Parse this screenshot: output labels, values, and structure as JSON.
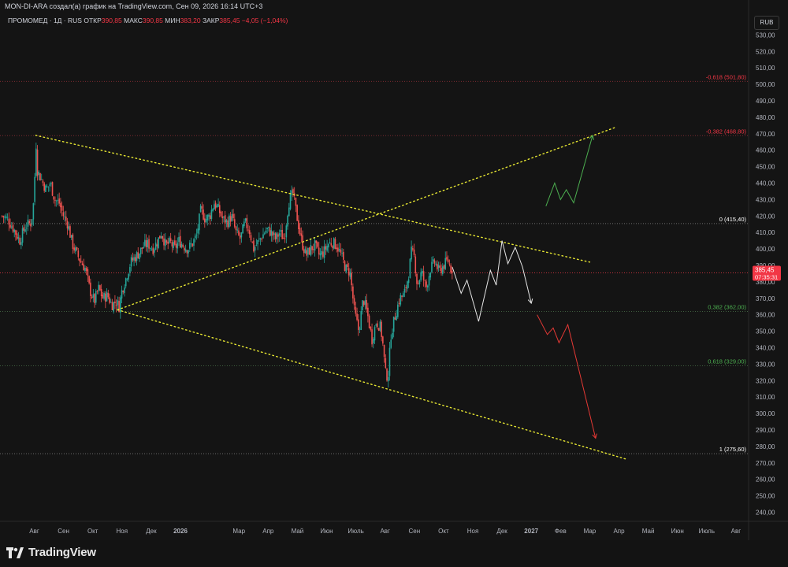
{
  "header": {
    "title": "MON-DI-ARA создал(а) график на TradingView.com, Сен 09, 2026 16:14 UTC+3"
  },
  "legend": {
    "symbol": "ПРОМОМЕД · 1Д · RUS",
    "open_label": "ОТКР",
    "open_value": "390,85",
    "high_label": "МАКС",
    "high_value": "390,85",
    "low_label": "МИН",
    "low_value": "383,20",
    "close_label": "ЗАКР",
    "close_value": "385,45",
    "change": "−4,05 (−1,04%)"
  },
  "price_axis": {
    "currency": "RUB",
    "last_price": "385,45",
    "countdown": "07:35:31"
  },
  "branding": {
    "logo_text": "TradingView"
  },
  "colors": {
    "background": "#141414",
    "up": "#26a69a",
    "down": "#ef5350",
    "trendline": "#e8e832",
    "fib_negative": "#f23645",
    "fib_positive": "#4caf50",
    "fib_neutral": "#ffffff",
    "last_price_tag": "#f23645",
    "scenario_neutral": "#e6e6e6",
    "scenario_bull": "#4caf50",
    "scenario_bear": "#e53935"
  },
  "chart_data": {
    "type": "candlestick",
    "title": "ПРОМОМЕД · 1Д · RUS",
    "ylim": [
      232,
      537
    ],
    "y_ticks": [
      530,
      520,
      510,
      500,
      490,
      480,
      470,
      460,
      450,
      440,
      430,
      420,
      410,
      400,
      390,
      380,
      370,
      360,
      350,
      340,
      330,
      320,
      310,
      300,
      290,
      280,
      270,
      260,
      250,
      240
    ],
    "y_tick_labels": [
      "530,00",
      "520,00",
      "510,00",
      "500,00",
      "490,00",
      "480,00",
      "470,00",
      "460,00",
      "450,00",
      "440,00",
      "430,00",
      "420,00",
      "410,00",
      "400,00",
      "390,00",
      "380,00",
      "370,00",
      "360,00",
      "350,00",
      "340,00",
      "330,00",
      "320,00",
      "310,00",
      "300,00",
      "290,00",
      "280,00",
      "270,00",
      "260,00",
      "250,00",
      "240,00"
    ],
    "x_ticks": [
      {
        "label": "Авг",
        "t": 0
      },
      {
        "label": "Сен",
        "t": 1
      },
      {
        "label": "Окт",
        "t": 2
      },
      {
        "label": "Ноя",
        "t": 3
      },
      {
        "label": "Дек",
        "t": 4
      },
      {
        "label": "2026",
        "t": 5,
        "bold": true
      },
      {
        "label": "Мар",
        "t": 7
      },
      {
        "label": "Апр",
        "t": 8
      },
      {
        "label": "Май",
        "t": 9
      },
      {
        "label": "Июн",
        "t": 10
      },
      {
        "label": "Июль",
        "t": 11
      },
      {
        "label": "Авг",
        "t": 12
      },
      {
        "label": "Сен",
        "t": 13
      },
      {
        "label": "Окт",
        "t": 14
      },
      {
        "label": "Ноя",
        "t": 15
      },
      {
        "label": "Дек",
        "t": 16
      },
      {
        "label": "2027",
        "t": 17,
        "bold": true
      },
      {
        "label": "Фев",
        "t": 18
      },
      {
        "label": "Мар",
        "t": 19
      },
      {
        "label": "Апр",
        "t": 20
      },
      {
        "label": "Май",
        "t": 21
      },
      {
        "label": "Июн",
        "t": 22
      },
      {
        "label": "Июль",
        "t": 23
      },
      {
        "label": "Авг",
        "t": 24
      }
    ],
    "price_path": [
      [
        -1.1,
        420
      ],
      [
        -0.9,
        418
      ],
      [
        -0.7,
        412
      ],
      [
        -0.5,
        405
      ],
      [
        -0.3,
        414
      ],
      [
        -0.1,
        416
      ],
      [
        0.0,
        432
      ],
      [
        0.05,
        469
      ],
      [
        0.1,
        448
      ],
      [
        0.25,
        442
      ],
      [
        0.4,
        436
      ],
      [
        0.55,
        440
      ],
      [
        0.7,
        430
      ],
      [
        0.85,
        428
      ],
      [
        1.0,
        420
      ],
      [
        1.15,
        415
      ],
      [
        1.3,
        403
      ],
      [
        1.45,
        397
      ],
      [
        1.6,
        392
      ],
      [
        1.75,
        388
      ],
      [
        1.9,
        375
      ],
      [
        2.05,
        368
      ],
      [
        2.2,
        376
      ],
      [
        2.35,
        370
      ],
      [
        2.5,
        372
      ],
      [
        2.65,
        366
      ],
      [
        2.8,
        368
      ],
      [
        2.9,
        365
      ],
      [
        3.0,
        375
      ],
      [
        3.15,
        383
      ],
      [
        3.3,
        392
      ],
      [
        3.45,
        395
      ],
      [
        3.6,
        398
      ],
      [
        3.75,
        402
      ],
      [
        3.9,
        403
      ],
      [
        4.05,
        400
      ],
      [
        4.2,
        404
      ],
      [
        4.35,
        410
      ],
      [
        4.5,
        402
      ],
      [
        4.65,
        404
      ],
      [
        4.8,
        400
      ],
      [
        4.95,
        405
      ],
      [
        5.1,
        402
      ],
      [
        5.25,
        400
      ],
      [
        5.4,
        403
      ],
      [
        5.55,
        408
      ],
      [
        5.7,
        424
      ],
      [
        5.85,
        418
      ],
      [
        6.0,
        420
      ],
      [
        6.15,
        428
      ],
      [
        6.3,
        424
      ],
      [
        6.45,
        418
      ],
      [
        6.6,
        416
      ],
      [
        6.75,
        420
      ],
      [
        6.9,
        410
      ],
      [
        7.05,
        406
      ],
      [
        7.2,
        416
      ],
      [
        7.35,
        412
      ],
      [
        7.5,
        400
      ],
      [
        7.65,
        404
      ],
      [
        7.8,
        408
      ],
      [
        7.95,
        412
      ],
      [
        8.1,
        410
      ],
      [
        8.25,
        406
      ],
      [
        8.4,
        410
      ],
      [
        8.55,
        406
      ],
      [
        8.7,
        428
      ],
      [
        8.85,
        434
      ],
      [
        9.0,
        418
      ],
      [
        9.15,
        404
      ],
      [
        9.3,
        396
      ],
      [
        9.45,
        400
      ],
      [
        9.6,
        402
      ],
      [
        9.75,
        396
      ],
      [
        9.9,
        398
      ],
      [
        10.05,
        403
      ],
      [
        10.2,
        404
      ],
      [
        10.35,
        402
      ],
      [
        10.5,
        396
      ],
      [
        10.65,
        388
      ],
      [
        10.8,
        386
      ],
      [
        10.95,
        362
      ],
      [
        11.1,
        350
      ],
      [
        11.25,
        370
      ],
      [
        11.4,
        360
      ],
      [
        11.55,
        345
      ],
      [
        11.7,
        356
      ],
      [
        11.85,
        352
      ],
      [
        11.95,
        338
      ],
      [
        12.0,
        325
      ],
      [
        12.1,
        322
      ],
      [
        12.2,
        348
      ],
      [
        12.35,
        360
      ],
      [
        12.5,
        370
      ],
      [
        12.65,
        372
      ],
      [
        12.8,
        384
      ],
      [
        12.9,
        398
      ],
      [
        13.0,
        395
      ],
      [
        13.1,
        378
      ],
      [
        13.25,
        386
      ],
      [
        13.4,
        376
      ],
      [
        13.55,
        388
      ],
      [
        13.7,
        392
      ],
      [
        13.85,
        386
      ],
      [
        14.0,
        390
      ],
      [
        14.15,
        393
      ],
      [
        14.3,
        385.45
      ]
    ],
    "fibonacci": [
      {
        "ratio": "-0,618",
        "price": 501.8,
        "label": "-0,618 (501,80)",
        "color": "#f23645"
      },
      {
        "ratio": "-0,382",
        "price": 468.8,
        "label": "-0,382 (468,80)",
        "color": "#f23645"
      },
      {
        "ratio": "0",
        "price": 415.4,
        "label": "0 (415,40)",
        "color": "#ffffff"
      },
      {
        "ratio": "0,382",
        "price": 362.0,
        "label": "0,382 (362,00)",
        "color": "#4caf50"
      },
      {
        "ratio": "0,618",
        "price": 329.0,
        "label": "0,618 (329,00)",
        "color": "#4caf50"
      },
      {
        "ratio": "1",
        "price": 275.6,
        "label": "1 (275,60)",
        "color": "#ffffff"
      }
    ],
    "trendlines": [
      {
        "from": [
          0.05,
          469
        ],
        "to": [
          19.0,
          392
        ]
      },
      {
        "from": [
          2.85,
          363
        ],
        "to": [
          19.9,
          474
        ]
      },
      {
        "from": [
          2.85,
          363
        ],
        "to": [
          20.3,
          272
        ]
      }
    ],
    "scenario_neutral": [
      [
        14.3,
        389
      ],
      [
        14.6,
        373
      ],
      [
        14.8,
        381
      ],
      [
        15.2,
        356
      ],
      [
        15.6,
        387
      ],
      [
        15.8,
        378
      ],
      [
        16.0,
        405
      ],
      [
        16.2,
        391
      ],
      [
        16.45,
        401
      ],
      [
        16.7,
        389
      ],
      [
        17.0,
        367
      ]
    ],
    "scenario_bull": [
      [
        17.5,
        426
      ],
      [
        17.8,
        440
      ],
      [
        18.0,
        430
      ],
      [
        18.2,
        436
      ],
      [
        18.45,
        428
      ],
      [
        19.1,
        469
      ]
    ],
    "scenario_bear": [
      [
        17.2,
        360
      ],
      [
        17.55,
        348
      ],
      [
        17.75,
        352
      ],
      [
        17.95,
        343
      ],
      [
        18.25,
        354
      ],
      [
        19.2,
        285
      ]
    ],
    "last_price": 385.45
  }
}
